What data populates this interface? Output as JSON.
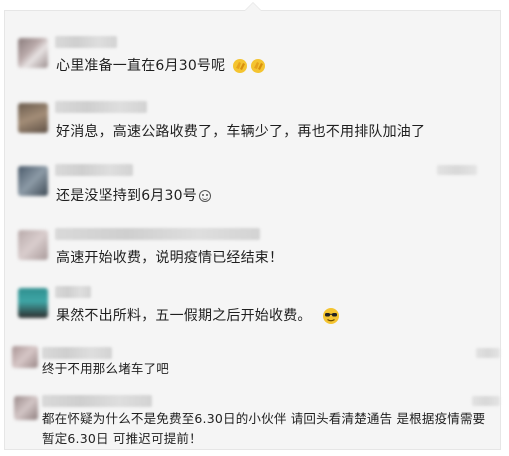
{
  "comments": [
    {
      "text": "心里准备一直在6月30号呢",
      "emoji": [
        "clapping-hands-icon",
        "clapping-hands-icon"
      ]
    },
    {
      "text": "好消息，高速公路收费了，车辆少了，再也不用排队加油了"
    },
    {
      "text": "还是没坚持到6月30号",
      "emoji": [
        "smiley-face-icon"
      ]
    },
    {
      "text": "高速开始收费，说明疫情已经结束！"
    },
    {
      "text": "果然不出所料，五一假期之后开始收费。",
      "emoji": [
        "sunglasses-face-icon"
      ]
    },
    {
      "text": "终于不用那么堵车了吧"
    },
    {
      "text": "都在怀疑为什么不是免费至6.30日的小伙伴 请回头看清楚通告  是根据疫情需要暂定6.30日  可推迟可提前！"
    }
  ],
  "colors": {
    "panel_bg": "#f5f5f5",
    "text": "#1f1f1f",
    "emoji_yellow": "#f4c430"
  }
}
